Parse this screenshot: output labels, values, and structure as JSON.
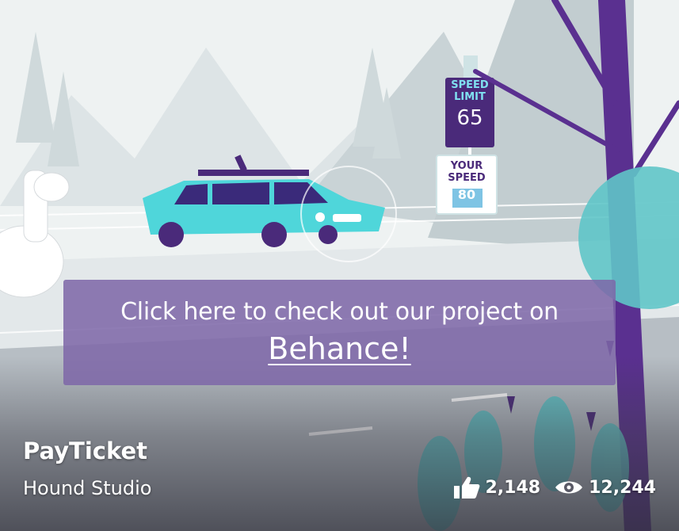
{
  "cta": {
    "line1": "Click here to check out our project on",
    "link": "Behance!"
  },
  "project": {
    "title": "PayTicket",
    "owner": "Hound Studio"
  },
  "stats": {
    "appreciations": "2,148",
    "views": "12,244"
  },
  "sign": {
    "speed_limit_label_1": "SPEED",
    "speed_limit_label_2": "LIMIT",
    "speed_limit_value": "65",
    "your_speed_label_1": "YOUR",
    "your_speed_label_2": "SPEED",
    "your_speed_value": "80"
  },
  "icons": [
    "thumbs-up-icon",
    "eye-icon"
  ],
  "colors": {
    "cta_bg": "#7e66a8",
    "car": "#4fd6da",
    "sign_dark": "#4a2a7a",
    "tree_trunk": "#5a3090",
    "teal_foliage": "#5fc5c8"
  }
}
